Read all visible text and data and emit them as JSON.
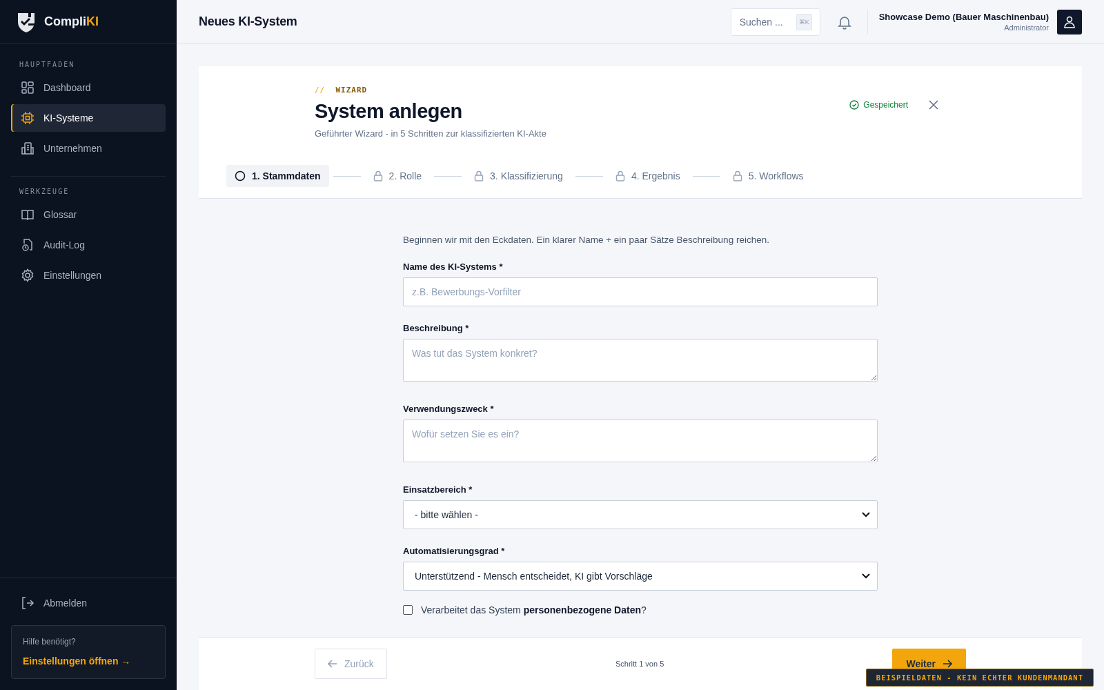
{
  "brand": {
    "name": "Compli",
    "accent": "KI"
  },
  "sidebar": {
    "sections": [
      {
        "title": "HAUPTFADEN",
        "items": [
          {
            "label": "Dashboard",
            "selected": false
          },
          {
            "label": "KI-Systeme",
            "selected": true
          },
          {
            "label": "Unternehmen",
            "selected": false
          }
        ]
      },
      {
        "title": "WERKZEUGE",
        "items": [
          {
            "label": "Glossar",
            "selected": false
          },
          {
            "label": "Audit-Log",
            "selected": false
          },
          {
            "label": "Einstellungen",
            "selected": false
          }
        ]
      }
    ],
    "logout": "Abmelden",
    "help": {
      "title": "Hilfe benötigt?",
      "link": "Einstellungen öffnen →"
    }
  },
  "header": {
    "title": "Neues KI-System",
    "search": {
      "placeholder": "Suchen ...",
      "shortcut": "⌘K"
    },
    "user": {
      "name": "Showcase Demo (Bauer Maschinenbau)",
      "role": "Administrator"
    }
  },
  "wizard": {
    "eyebrow_prefix": "//",
    "eyebrow": "WIZARD",
    "title": "System anlegen",
    "subtitle": "Geführter Wizard - in 5 Schritten zur klassifizierten KI-Akte",
    "status": "Gespeichert",
    "steps": [
      {
        "label": "1. Stammdaten",
        "selected": true,
        "locked": false
      },
      {
        "label": "2. Rolle",
        "selected": false,
        "locked": true
      },
      {
        "label": "3. Klassifizierung",
        "selected": false,
        "locked": true
      },
      {
        "label": "4. Ergebnis",
        "selected": false,
        "locked": true
      },
      {
        "label": "5. Workflows",
        "selected": false,
        "locked": true
      }
    ]
  },
  "form": {
    "intro": "Beginnen wir mit den Eckdaten. Ein klarer Name + ein paar Sätze Beschreibung reichen.",
    "fields": [
      {
        "kind": "input",
        "label": "Name des KI-Systems *",
        "placeholder": "z.B. Bewerbungs-Vorfilter"
      },
      {
        "kind": "textarea",
        "label": "Beschreibung *",
        "placeholder": "Was tut das System konkret?"
      },
      {
        "kind": "textarea",
        "label": "Verwendungszweck *",
        "placeholder": "Wofür setzen Sie es ein?"
      },
      {
        "kind": "select",
        "label": "Einsatzbereich *",
        "value": "- bitte wählen -"
      },
      {
        "kind": "select",
        "label": "Automatisierungsgrad *",
        "value": "Unterstützend - Mensch entscheidet, KI gibt Vorschläge"
      }
    ],
    "checkbox": {
      "label": "Verarbeitet das System **personenbezogene Daten**?",
      "checked": false
    }
  },
  "footer": {
    "back": {
      "label": "Zurück",
      "disabled": true
    },
    "progress": "Schritt 1 von 5",
    "next": {
      "label": "Weiter"
    }
  },
  "banner": "BEISPIELDATEN - KEIN ECHTER KUNDENMANDANT"
}
